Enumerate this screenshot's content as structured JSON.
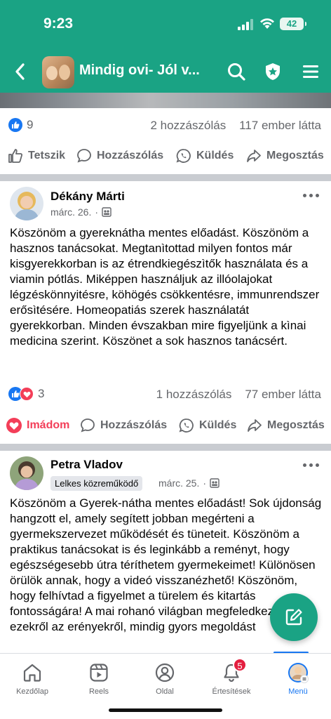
{
  "status_bar": {
    "time": "9:23",
    "battery": "42"
  },
  "header": {
    "group_name": "Mindig ovi- Jól v..."
  },
  "post1_footer": {
    "likes": "9",
    "comments": "2 hozzászólás",
    "views": "117 ember látta",
    "actions": {
      "like": "Tetszik",
      "comment": "Hozzászólás",
      "send": "Küldés",
      "share": "Megosztás"
    }
  },
  "post2": {
    "author": "Dékány Márti",
    "date": "márc. 26.",
    "text": "Köszönöm a gyereknátha mentes előadást. Köszönöm a hasznos tanácsokat. Megtanìtottad milyen fontos  már kisgyerekkorban  is az étrendkiegészìtők használata és a viamin pótlás. Miképpen használjuk az illóolajokat légzéskönnyitésre, köhögés csökkentésre, immunrendszer erősìtésére. Homeopatiás szerek használatát gyerekkorban. Minden évszakban mire figyeljünk a kìnai medicina szerint. Köszönet a sok hasznos tanácsért.",
    "reactions": "3",
    "comments": "1 hozzászólás",
    "views": "77 ember látta",
    "actions": {
      "like": "Imádom",
      "comment": "Hozzászólás",
      "send": "Küldés",
      "share": "Megosztás"
    }
  },
  "post3": {
    "author": "Petra Vladov",
    "badge": "Lelkes közreműködő",
    "date": "márc. 25.",
    "text": "Köszönöm a Gyerek-nátha mentes előadást! Sok újdonság hangzott el, amely segített jobban megérteni a gyermekszervezet működését és tüneteit. Köszönöm a praktikus tanácsokat is és leginkább a reményt, hogy egészségesebb útra téríthetem gyermekeimet! Különösen örülök annak, hogy a videó visszanézhető! Köszönöm, hogy felhívtad a figyelmet a türelem és kitartás fontosságára! A mai rohanó világban megfeledkezünk ezekről az erényekről, mindig gyors megoldást"
  },
  "tabbar": {
    "home": "Kezdőlap",
    "reels": "Reels",
    "profile": "Oldal",
    "notifications": "Értesítések",
    "notifications_count": "5",
    "menu": "Menü"
  },
  "colors": {
    "brand": "#1aa384",
    "link": "#1877f2",
    "love": "#f33e58"
  }
}
